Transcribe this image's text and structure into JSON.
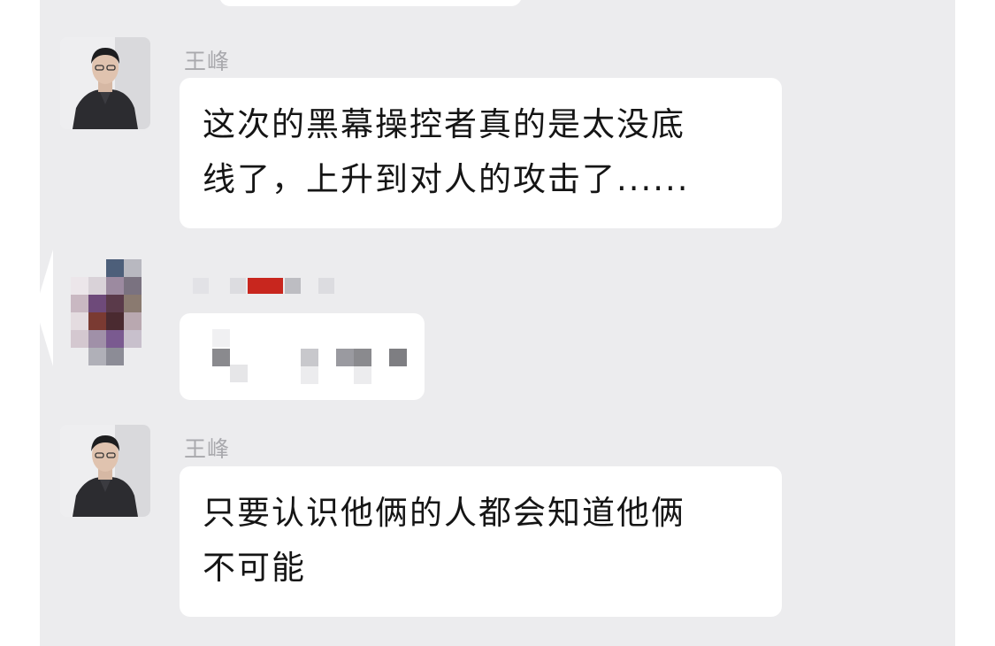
{
  "messages": [
    {
      "sender": "王峰",
      "lines": [
        "这次的黑幕操控者真的是太没底",
        "线了，上升到对人的攻击了......"
      ]
    },
    {
      "sender": "",
      "lines": [],
      "redacted": true
    },
    {
      "sender": "王峰",
      "lines": [
        "只要认识他俩的人都会知道他俩",
        "不可能"
      ]
    }
  ],
  "colors": {
    "chat_background": "#ececee",
    "bubble": "#ffffff",
    "sender_name": "#a9a9ad",
    "text": "#151515"
  }
}
